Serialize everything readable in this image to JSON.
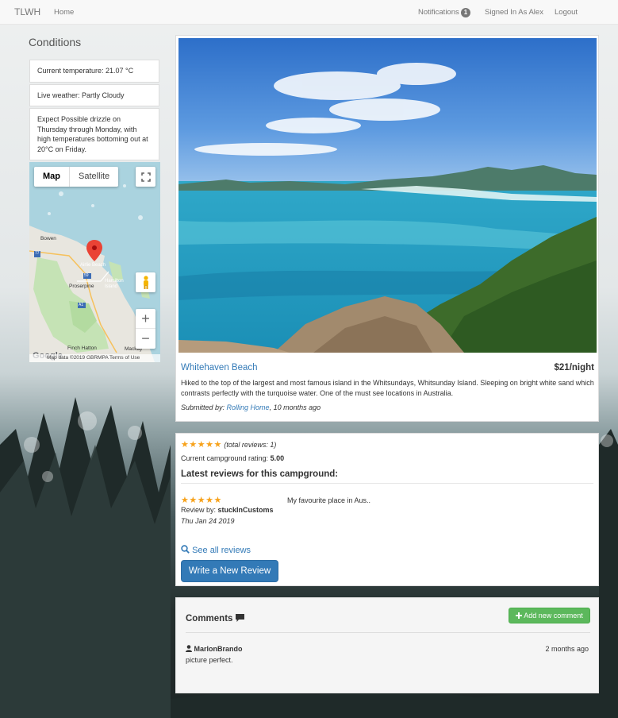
{
  "navbar": {
    "brand": "TLWH",
    "home": "Home",
    "notifications": "Notifications",
    "notification_count": "1",
    "signed_in": "Signed In As Alex",
    "logout": "Logout"
  },
  "conditions": {
    "title": "Conditions",
    "items": [
      "Current temperature: 21.07 °C",
      "Live weather: Partly Cloudy",
      "Expect Possible drizzle on Thursday through Monday, with high temperatures bottoming out at 20°C on Friday."
    ]
  },
  "map": {
    "tabs": [
      "Map",
      "Satellite"
    ],
    "active_tab": "Map",
    "labels": {
      "bowen": "Bowen",
      "airlie": "Airlie Beach",
      "proserpine": "Proserpine",
      "hamilton": "Hamilton Island",
      "finch": "Finch Hatton",
      "mackay": "Mackay",
      "road77": "77",
      "road59": "59",
      "roadA1": "A1"
    },
    "google": "Google",
    "footer": "Map data ©2019 GBRMPA   Terms of Use"
  },
  "campground": {
    "name": "Whitehaven Beach",
    "price": "$21/night",
    "description": "Hiked to the top of the largest and most famous island in the Whitsundays, Whitsunday Island. Sleeping on bright white sand which contrasts perfectly with the turquoise water. One of the must see locations in Australia.",
    "submitted_prefix": "Submitted by: ",
    "submitted_by": "Rolling Home",
    "submitted_time": ", 10 months ago"
  },
  "reviews": {
    "stars": "★★★★★",
    "total": "(total reviews: 1)",
    "rating_label": "Current campground rating: ",
    "rating_value": "5.00",
    "heading": "Latest reviews for this campground:",
    "items": [
      {
        "stars": "★★★★★",
        "by_label": "Review by: ",
        "author": "stuckInCustoms",
        "date": "Thu Jan 24 2019",
        "text": "My favourite place in Aus.."
      }
    ],
    "see_all": "See all reviews",
    "write_button": "Write a New Review"
  },
  "comments": {
    "title": "Comments",
    "add_button": "Add new comment",
    "items": [
      {
        "user": "MarlonBrando",
        "time": "2 months ago",
        "text": "picture perfect."
      }
    ]
  },
  "colors": {
    "link": "#337ab7",
    "primary": "#337ab7",
    "success": "#5cb85c",
    "star": "#f7a21b"
  }
}
